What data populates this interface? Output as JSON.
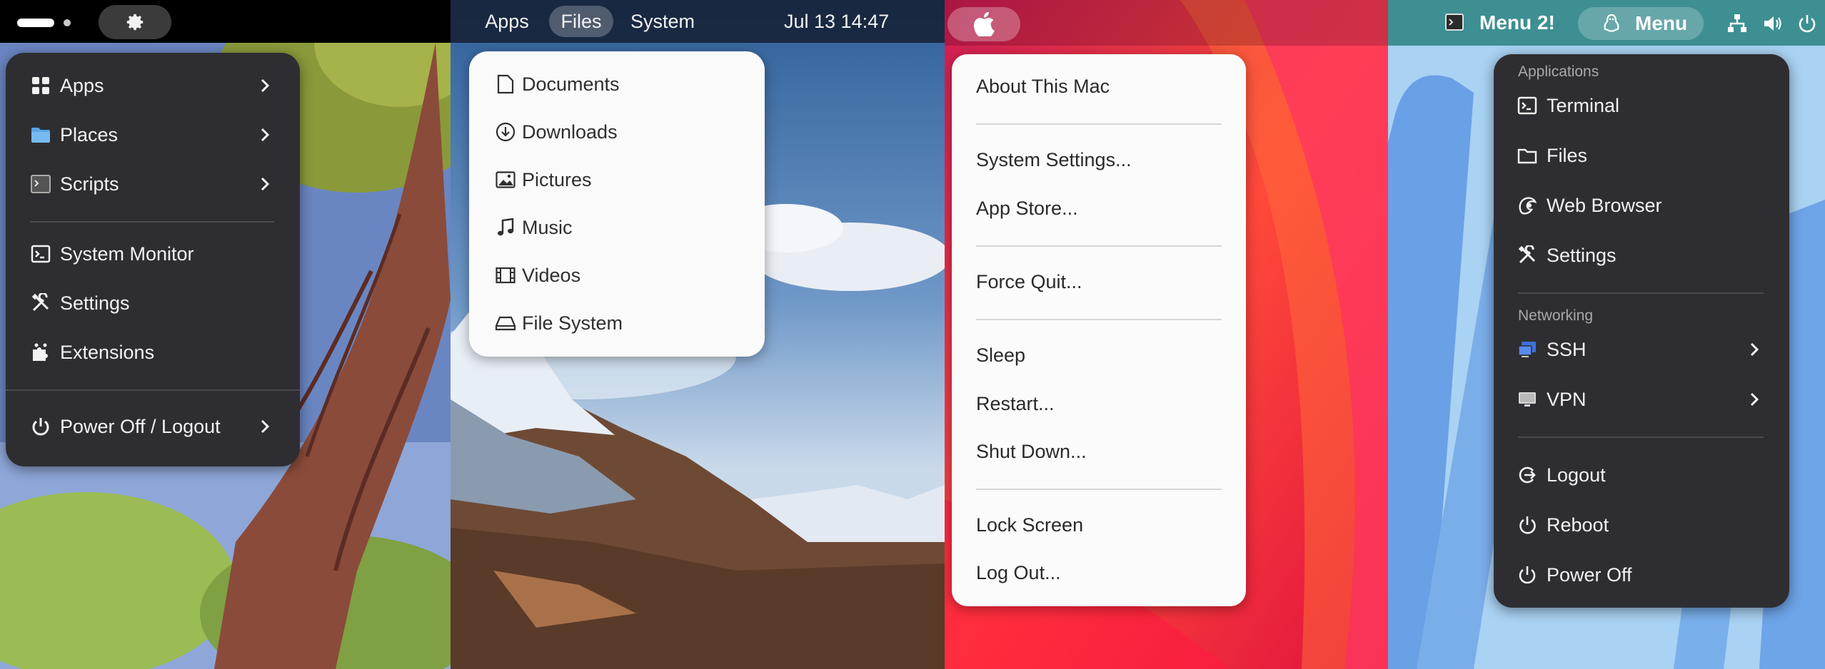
{
  "panel1": {
    "items": [
      {
        "label": "Apps",
        "icon": "grid-icon",
        "submenu": true
      },
      {
        "label": "Places",
        "icon": "folder-icon",
        "submenu": true
      },
      {
        "label": "Scripts",
        "icon": "terminal-icon",
        "submenu": true
      },
      {
        "label": "System Monitor",
        "icon": "terminal-prompt-icon",
        "submenu": false
      },
      {
        "label": "Settings",
        "icon": "tools-icon",
        "submenu": false
      },
      {
        "label": "Extensions",
        "icon": "puzzle-icon",
        "submenu": false
      },
      {
        "label": "Power Off / Logout",
        "icon": "power-icon",
        "submenu": true
      }
    ]
  },
  "panel2": {
    "tabs": [
      {
        "label": "Apps"
      },
      {
        "label": "Files"
      },
      {
        "label": "System"
      }
    ],
    "clock": "Jul 13  14:47",
    "items": [
      {
        "label": "Documents",
        "icon": "document-icon"
      },
      {
        "label": "Downloads",
        "icon": "download-icon"
      },
      {
        "label": "Pictures",
        "icon": "picture-icon"
      },
      {
        "label": "Music",
        "icon": "music-note-icon"
      },
      {
        "label": "Videos",
        "icon": "film-icon"
      },
      {
        "label": "File System",
        "icon": "drive-icon"
      }
    ]
  },
  "panel3": {
    "items": [
      {
        "label": "About This Mac"
      },
      {
        "label": "System Settings..."
      },
      {
        "label": "App Store..."
      },
      {
        "label": "Force Quit..."
      },
      {
        "label": "Sleep"
      },
      {
        "label": "Restart..."
      },
      {
        "label": "Shut Down..."
      },
      {
        "label": "Lock Screen"
      },
      {
        "label": "Log Out..."
      }
    ]
  },
  "panel4": {
    "topbar": {
      "menu2_label": "Menu 2!",
      "menu_label": "Menu"
    },
    "sections": {
      "applications": "Applications",
      "networking": "Networking"
    },
    "items": [
      {
        "label": "Terminal",
        "icon": "terminal-icon"
      },
      {
        "label": "Files",
        "icon": "folder-icon"
      },
      {
        "label": "Web Browser",
        "icon": "browser-icon"
      },
      {
        "label": "Settings",
        "icon": "tools-icon"
      },
      {
        "label": "SSH",
        "icon": "network-monitor-icon",
        "submenu": true
      },
      {
        "label": "VPN",
        "icon": "monitor-icon",
        "submenu": true
      },
      {
        "label": "Logout",
        "icon": "logout-icon"
      },
      {
        "label": "Reboot",
        "icon": "reboot-icon"
      },
      {
        "label": "Power Off",
        "icon": "power-icon"
      }
    ]
  },
  "colors": {
    "dark_menu": "#2e2e32",
    "light_menu": "#fafafa",
    "teal_bar": "#3d8f92",
    "mac_bg_red": "#f0254c"
  }
}
